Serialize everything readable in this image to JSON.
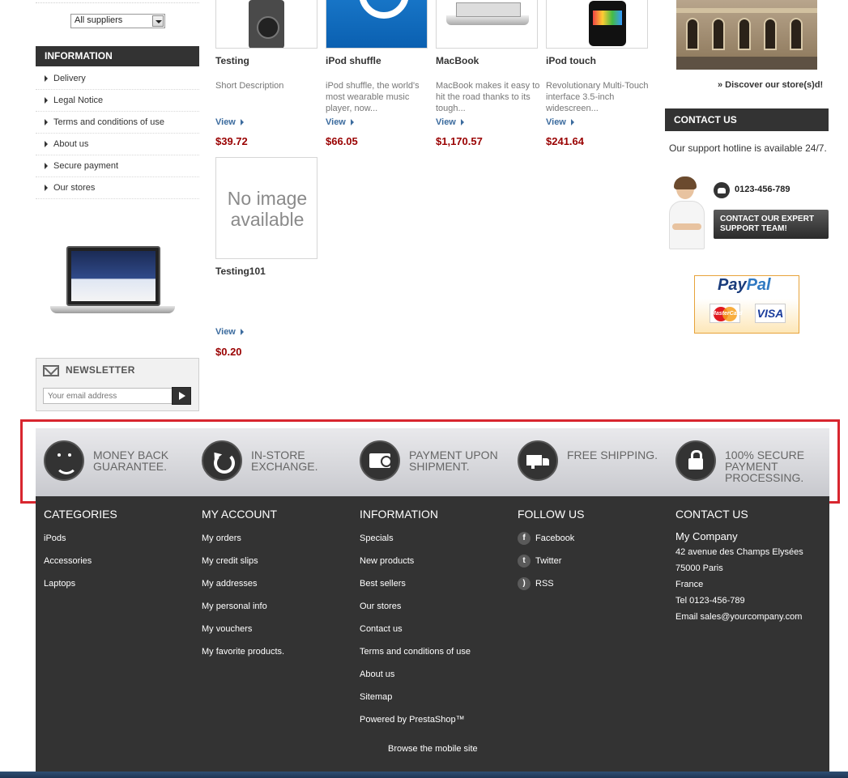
{
  "left": {
    "supplier_select": "All suppliers",
    "information_title": "INFORMATION",
    "information_items": [
      "Delivery",
      "Legal Notice",
      "Terms and conditions of use",
      "About us",
      "Secure payment",
      "Our stores"
    ],
    "newsletter_title": "NEWSLETTER",
    "newsletter_placeholder": "Your email address"
  },
  "products": [
    {
      "name": "Testing",
      "desc": "Short Description",
      "view": "View",
      "price": "$39.72"
    },
    {
      "name": "iPod shuffle",
      "desc": "iPod shuffle, the world's most wearable music player, now...",
      "view": "View",
      "price": "$66.05"
    },
    {
      "name": "MacBook",
      "desc": "MacBook makes it easy to hit the road thanks to its tough...",
      "view": "View",
      "price": "$1,170.57"
    },
    {
      "name": "iPod touch",
      "desc": "Revolutionary Multi-Touch interface 3.5-inch widescreen...",
      "view": "View",
      "price": "$241.64"
    },
    {
      "name": "Testing101",
      "desc": "",
      "view": "View",
      "price": "$0.20",
      "noimage": "No image available"
    }
  ],
  "right": {
    "discover": "» Discover our store(s)d!",
    "contact_title": "CONTACT US",
    "hotline": "Our support hotline is available 24/7.",
    "phone": "0123-456-789",
    "expert_button": "CONTACT OUR EXPERT SUPPORT TEAM!",
    "paypal_word": "PayPal",
    "paypal_pay": "Pay",
    "paypal_pal": "Pal",
    "mastercard": "MasterCard",
    "visa": "VISA"
  },
  "reassurance": [
    {
      "text": "MONEY BACK GUARANTEE.",
      "icon": "smile-icon"
    },
    {
      "text": "IN-STORE EXCHANGE.",
      "icon": "refresh-icon"
    },
    {
      "text": "PAYMENT UPON SHIPMENT.",
      "icon": "payment-card-icon"
    },
    {
      "text": "FREE SHIPPING.",
      "icon": "truck-icon"
    },
    {
      "text": "100% SECURE PAYMENT PROCESSING.",
      "icon": "lock-icon"
    }
  ],
  "footer": {
    "categories": {
      "title": "CATEGORIES",
      "links": [
        "iPods",
        "Accessories",
        "Laptops"
      ]
    },
    "account": {
      "title": "MY ACCOUNT",
      "links": [
        "My orders",
        "My credit slips",
        "My addresses",
        "My personal info",
        "My vouchers",
        "My favorite products."
      ]
    },
    "information": {
      "title": "INFORMATION",
      "links": [
        "Specials",
        "New products",
        "Best sellers",
        "Our stores",
        "Contact us",
        "Terms and conditions of use",
        "About us",
        "Sitemap",
        "Powered by PrestaShop™"
      ]
    },
    "follow": {
      "title": "FOLLOW US",
      "links": [
        "Facebook",
        "Twitter",
        "RSS"
      ]
    },
    "contact": {
      "title": "CONTACT US",
      "company": "My Company",
      "lines": [
        "42 avenue des Champs Elysées",
        "75000 Paris",
        "France",
        "Tel 0123-456-789",
        "Email sales@yourcompany.com"
      ]
    },
    "mobile_link": "Browse the mobile site"
  },
  "colors": {
    "accent_price": "#990000",
    "dark_block": "#333333",
    "link_blue": "#3b6b9e",
    "highlight_frame": "#d8262f"
  }
}
